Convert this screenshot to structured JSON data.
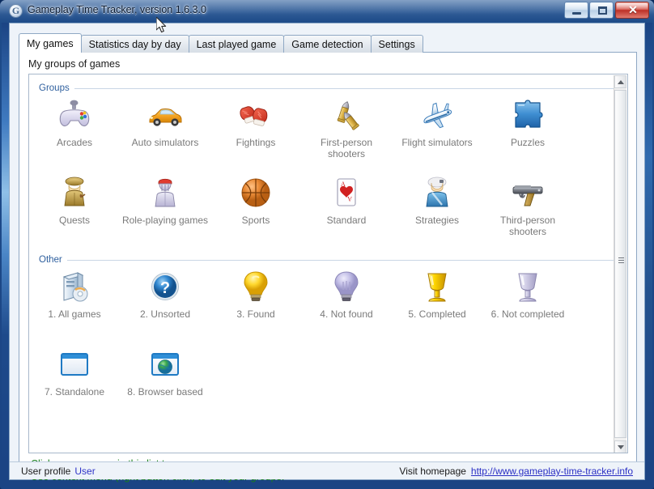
{
  "window": {
    "title": "Gameplay Time Tracker, version 1.6.3.0",
    "app_icon": "G",
    "minimize_label": "—",
    "maximize_label": "□",
    "close_label": "✕"
  },
  "tabs": [
    {
      "label": "My games",
      "active": true
    },
    {
      "label": "Statistics day by day",
      "active": false
    },
    {
      "label": "Last played game",
      "active": false
    },
    {
      "label": "Game detection",
      "active": false
    },
    {
      "label": "Settings",
      "active": false
    }
  ],
  "page": {
    "heading": "My groups of games"
  },
  "sections": [
    {
      "title": "Groups",
      "rows": [
        [
          {
            "label": "Arcades",
            "icon": "gamepad-icon"
          },
          {
            "label": "Auto simulators",
            "icon": "car-icon"
          },
          {
            "label": "Fightings",
            "icon": "boxing-gloves-icon"
          },
          {
            "label": "First-person shooters",
            "icon": "bullets-icon"
          },
          {
            "label": "Flight simulators",
            "icon": "airplane-icon"
          },
          {
            "label": "Puzzles",
            "icon": "puzzle-piece-icon"
          }
        ],
        [
          {
            "label": "Quests",
            "icon": "detective-icon"
          },
          {
            "label": "Role-playing games",
            "icon": "knight-icon"
          },
          {
            "label": "Sports",
            "icon": "basketball-icon"
          },
          {
            "label": "Standard",
            "icon": "playing-card-icon"
          },
          {
            "label": "Strategies",
            "icon": "soldier-icon"
          },
          {
            "label": "Third-person shooters",
            "icon": "pistol-icon"
          }
        ]
      ]
    },
    {
      "title": "Other",
      "rows": [
        [
          {
            "label": "1. All games",
            "icon": "computer-disc-icon"
          },
          {
            "label": "2. Unsorted",
            "icon": "question-mark-icon"
          },
          {
            "label": "3. Found",
            "icon": "lightbulb-on-icon"
          },
          {
            "label": "4. Not found",
            "icon": "lightbulb-off-icon"
          },
          {
            "label": "5. Completed",
            "icon": "gold-trophy-icon"
          },
          {
            "label": "6. Not completed",
            "icon": "silver-trophy-icon"
          }
        ],
        [
          {
            "label": "7. Standalone",
            "icon": "window-icon"
          },
          {
            "label": "8. Browser based",
            "icon": "browser-globe-icon"
          }
        ]
      ]
    }
  ],
  "hints": [
    "Click on any group in this list to access your games.",
    "Use context menu (right button click) to edit your groups."
  ],
  "statusbar": {
    "profile_label": "User profile",
    "profile_value": "User",
    "homepage_label": "Visit homepage",
    "homepage_url": "http://www.gameplay-time-tracker.info"
  },
  "colors": {
    "title_bar": "#1d4b89",
    "section_label": "#2e5f9e",
    "hint_text": "#18801d",
    "link": "#2a2fc4",
    "caption": "#7a7a7a",
    "close_button": "#bd3127"
  }
}
